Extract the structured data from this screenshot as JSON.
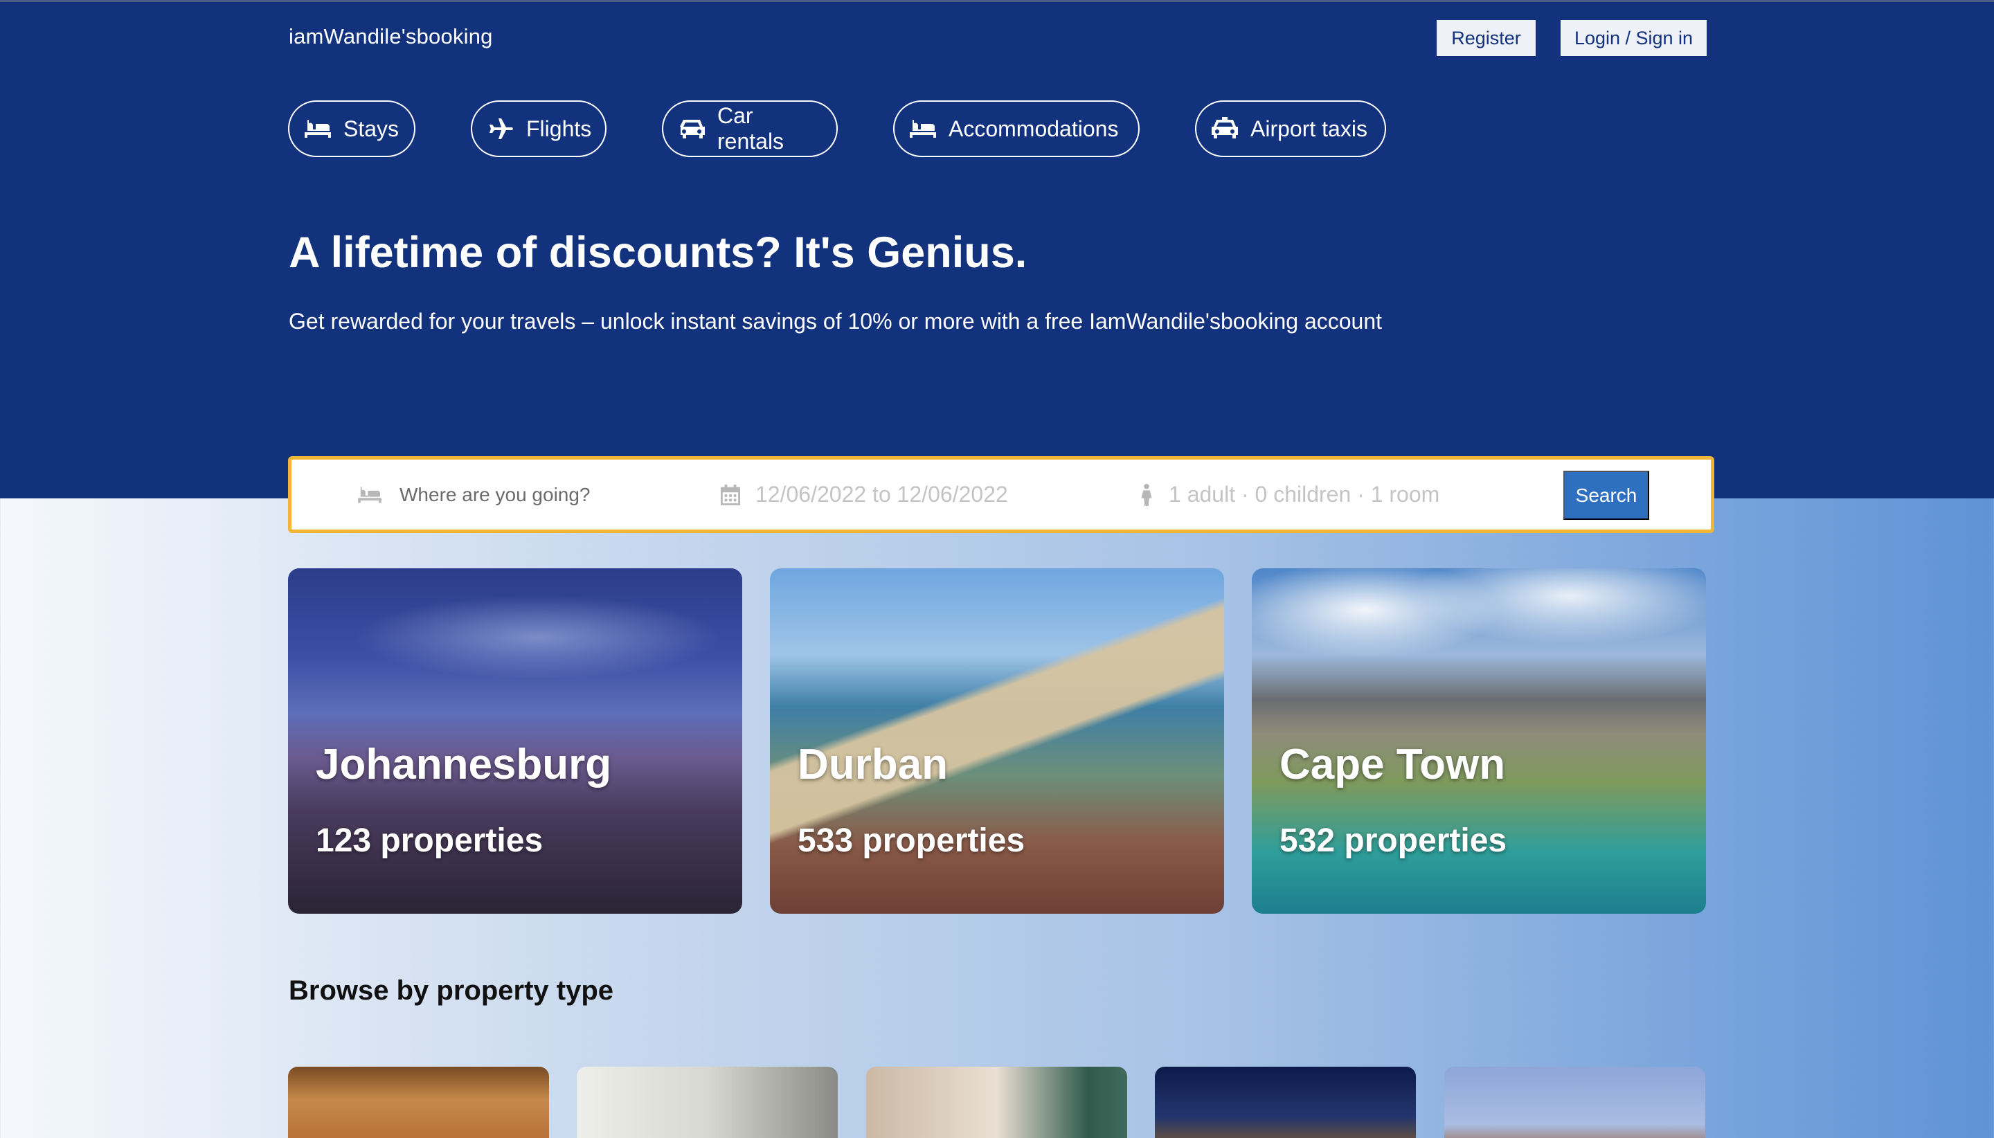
{
  "header": {
    "logo": "iamWandile'sbooking",
    "register_label": "Register",
    "login_label": "Login / Sign in"
  },
  "nav": {
    "items": [
      {
        "label": "Stays",
        "icon": "bed-icon"
      },
      {
        "label": "Flights",
        "icon": "plane-icon"
      },
      {
        "label": "Car rentals",
        "icon": "car-icon"
      },
      {
        "label": "Accommodations",
        "icon": "bed-icon"
      },
      {
        "label": "Airport taxis",
        "icon": "taxi-icon"
      }
    ]
  },
  "hero": {
    "headline": "A lifetime of discounts? It's Genius.",
    "subline": "Get rewarded for your travels – unlock instant savings of 10% or more with a free IamWandile'sbooking account"
  },
  "search": {
    "destination_placeholder": "Where are you going?",
    "dates": "12/06/2022 to 12/06/2022",
    "guests": "1 adult · 0 children · 1 room",
    "button_label": "Search"
  },
  "featured": [
    {
      "city": "Johannesburg",
      "properties": "123 properties"
    },
    {
      "city": "Durban",
      "properties": "533 properties"
    },
    {
      "city": "Cape Town",
      "properties": "532 properties"
    }
  ],
  "browse": {
    "title": "Browse by property type"
  },
  "colors": {
    "brand_blue": "#12327d",
    "accent_yellow": "#f2b636",
    "button_blue": "#2f6fbf"
  }
}
